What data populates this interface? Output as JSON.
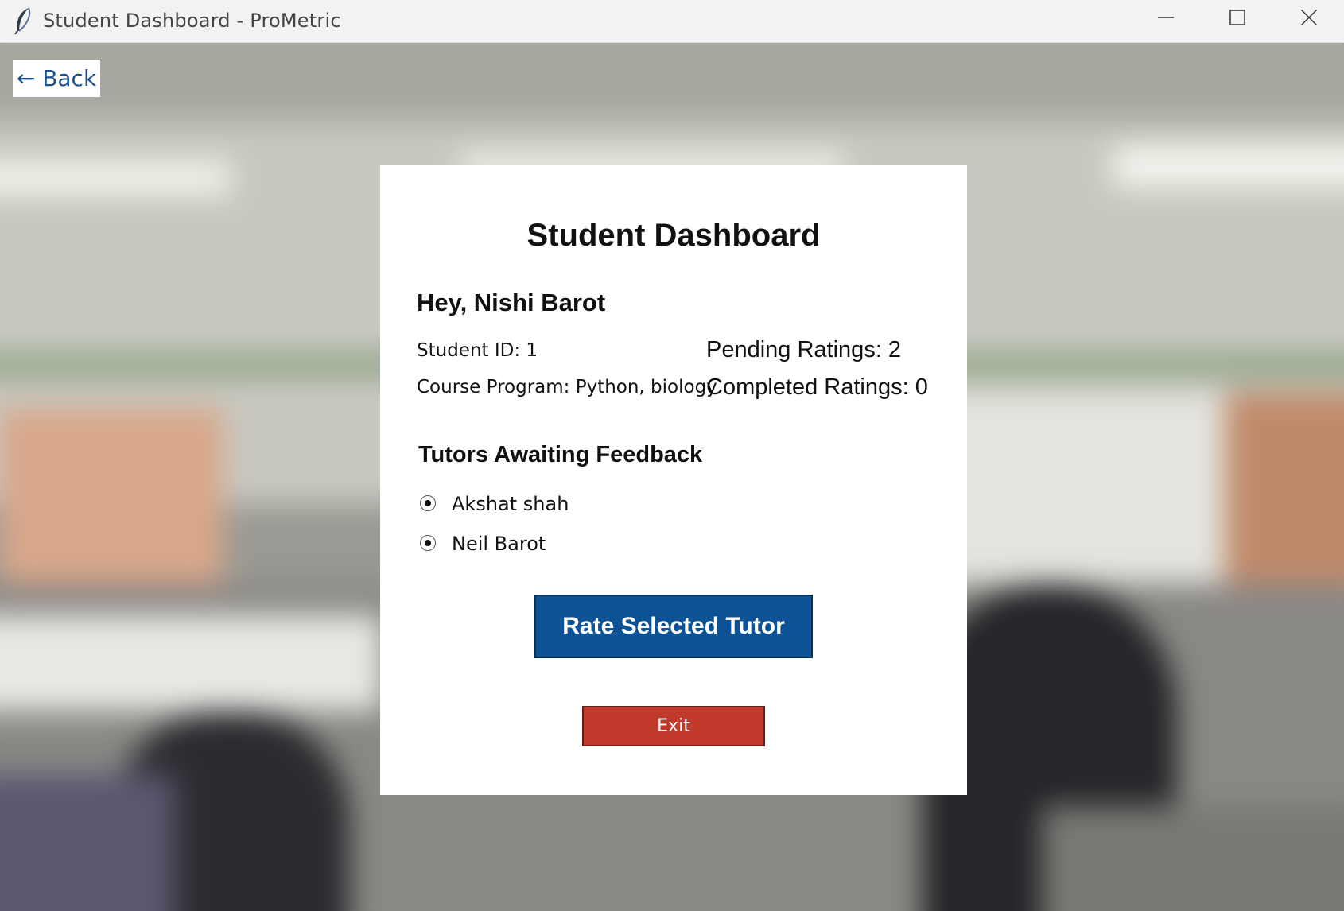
{
  "window": {
    "title": "Student Dashboard - ProMetric",
    "app_icon": "feather-icon",
    "controls": [
      "minimize-icon",
      "maximize-icon",
      "close-icon"
    ]
  },
  "back_button": {
    "label": "← Back"
  },
  "dashboard": {
    "title": "Student Dashboard",
    "greeting": "Hey, Nishi Barot",
    "student_id": "Student ID: 1",
    "course_program": "Course Program: Python, biology",
    "pending_ratings": "Pending Ratings: 2",
    "completed_ratings": "Completed Ratings: 0"
  },
  "tutors_section": {
    "title": "Tutors Awaiting Feedback",
    "tutors": [
      {
        "name": "Akshat shah"
      },
      {
        "name": "Neil Barot"
      }
    ]
  },
  "actions": {
    "rate_label": "Rate Selected Tutor",
    "exit_label": "Exit"
  },
  "colors": {
    "rate_button": "#0d5294",
    "exit_button": "#c0392b",
    "back_text": "#1d4f8c"
  }
}
